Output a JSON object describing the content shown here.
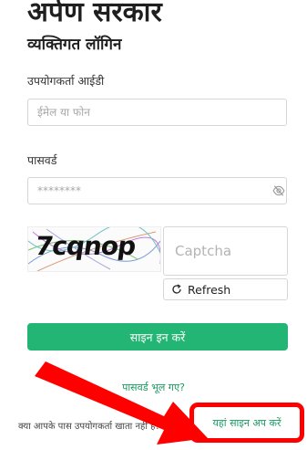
{
  "header": {
    "brand": "अर्पण सरकार",
    "subtitle": "व्यक्तिगत लॉगिन"
  },
  "form": {
    "user_label": "उपयोगकर्ता आईडी",
    "user_placeholder": "ईमेल या फोन",
    "password_label": "पासवर्ड",
    "password_placeholder": "********",
    "captcha_text": "7cqnop",
    "captcha_placeholder": "Captcha",
    "refresh_label": "Refresh",
    "signin_label": "साइन इन करें",
    "forgot_label": "पासवर्ड भूल गए?",
    "no_account_text": "क्या आपके पास उपयोगकर्ता खाता नहीं है?",
    "signup_label": "यहां साइन अप करें"
  },
  "icons": {
    "password_toggle": "eye-slash-icon",
    "refresh": "refresh-icon"
  },
  "colors": {
    "primary": "#22b573",
    "link": "#1a9a63",
    "highlight": "#ff0000"
  }
}
